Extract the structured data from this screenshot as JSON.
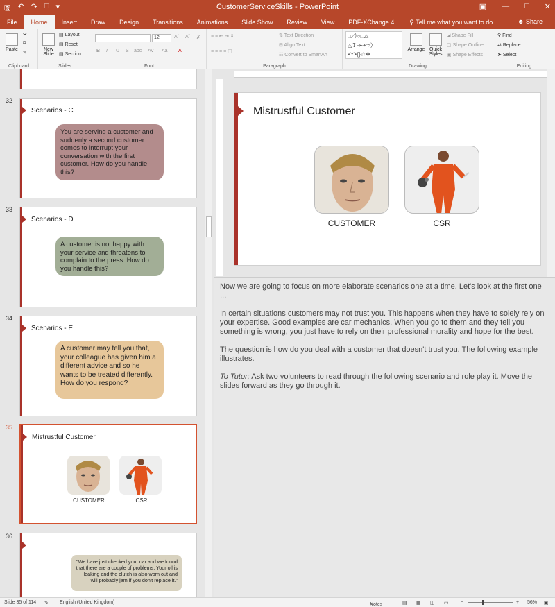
{
  "titlebar": {
    "title": "CustomerServiceSkills  -  PowerPoint",
    "qat": [
      "save-icon",
      "undo-icon",
      "redo-icon",
      "start-icon",
      "customize-icon"
    ],
    "controls": [
      "ribbon-options-icon",
      "minimize-icon",
      "maximize-icon",
      "close-icon"
    ]
  },
  "tabs": [
    "File",
    "Home",
    "Insert",
    "Draw",
    "Design",
    "Transitions",
    "Animations",
    "Slide Show",
    "Review",
    "View",
    "PDF-XChange 4"
  ],
  "tell_me": "Tell me what you want to do",
  "share": "Share",
  "ribbon": {
    "clipboard": {
      "label": "Clipboard",
      "paste": "Paste"
    },
    "slides": {
      "label": "Slides",
      "new_slide": "New\nSlide",
      "layout": "Layout",
      "reset": "Reset",
      "section": "Section"
    },
    "font": {
      "label": "Font",
      "size": "12",
      "buttons": [
        "B",
        "I",
        "U",
        "S",
        "abc",
        "AV",
        "Aa",
        "A"
      ]
    },
    "paragraph": {
      "label": "Paragraph",
      "text_direction": "Text Direction",
      "align_text": "Align Text",
      "convert": "Convert to SmartArt"
    },
    "drawing": {
      "label": "Drawing",
      "arrange": "Arrange",
      "quick_styles": "Quick\nStyles",
      "shape_fill": "Shape Fill",
      "shape_outline": "Shape Outline",
      "shape_effects": "Shape Effects"
    },
    "editing": {
      "label": "Editing",
      "find": "Find",
      "replace": "Replace",
      "select": "Select"
    }
  },
  "thumbnails": {
    "slide31_num": "",
    "slides": [
      {
        "num": "32",
        "title": "Scenarios - C",
        "bubble": "You are serving a customer and suddenly a second customer comes to interrupt your conversation with the first customer. How do you handle this?",
        "color": "#b38c8c"
      },
      {
        "num": "33",
        "title": "Scenarios - D",
        "bubble": "A customer is not happy with your service and threatens to complain to the press. How do you handle this?",
        "color": "#a2ae96"
      },
      {
        "num": "34",
        "title": "Scenarios - E",
        "bubble": "A customer may tell you that, your colleague has given him a different advice and so he wants to be treated differently. How do you respond?",
        "color": "#e7c79a"
      },
      {
        "num": "35",
        "title": "Mistrustful Customer",
        "label_customer": "CUSTOMER",
        "label_csr": "CSR"
      },
      {
        "num": "36",
        "bubble": "\"We have just checked your car and we found that there are a couple of problems. Your oil is leaking and the clutch is also worn out and will probably jam if you don't replace it.\"",
        "color": "#d8d2bf"
      }
    ]
  },
  "slide": {
    "title": "Mistrustful Customer",
    "label_customer": "CUSTOMER",
    "label_csr": "CSR"
  },
  "notes": {
    "p1": "Now we are going to focus on more elaborate scenarios one at a time. Let's look at the first one ...",
    "p2": "In certain situations customers may not trust you. This happens when they have to solely rely on your expertise. Good examples are car mechanics. When you go to them and they tell you something is wrong, you just have to rely on their professional morality and hope for the best.",
    "p3": "The question is how do you deal with a customer that doesn't trust you. The following example illustrates.",
    "p4_label": "To Tutor:",
    "p4": " Ask two volunteers to read through the following scenario and role play it. Move the slides forward as they go through it."
  },
  "status": {
    "slide_info": "Slide 35 of 114",
    "language": "English (United Kingdom)",
    "notes": "Notes",
    "zoom": "56%"
  }
}
